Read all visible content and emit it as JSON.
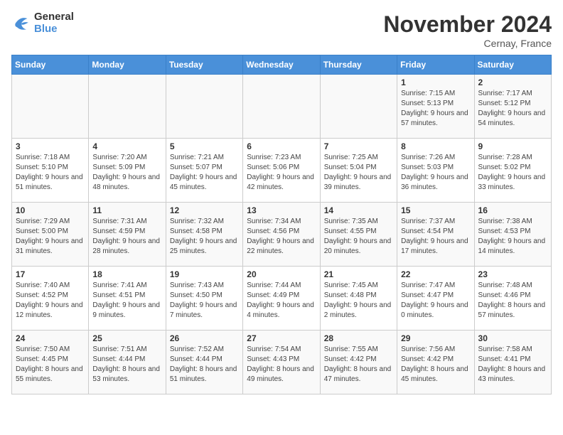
{
  "header": {
    "logo_general": "General",
    "logo_blue": "Blue",
    "month_title": "November 2024",
    "subtitle": "Cernay, France"
  },
  "weekdays": [
    "Sunday",
    "Monday",
    "Tuesday",
    "Wednesday",
    "Thursday",
    "Friday",
    "Saturday"
  ],
  "weeks": [
    [
      {
        "day": "",
        "info": ""
      },
      {
        "day": "",
        "info": ""
      },
      {
        "day": "",
        "info": ""
      },
      {
        "day": "",
        "info": ""
      },
      {
        "day": "",
        "info": ""
      },
      {
        "day": "1",
        "info": "Sunrise: 7:15 AM\nSunset: 5:13 PM\nDaylight: 9 hours\nand 57 minutes."
      },
      {
        "day": "2",
        "info": "Sunrise: 7:17 AM\nSunset: 5:12 PM\nDaylight: 9 hours\nand 54 minutes."
      }
    ],
    [
      {
        "day": "3",
        "info": "Sunrise: 7:18 AM\nSunset: 5:10 PM\nDaylight: 9 hours\nand 51 minutes."
      },
      {
        "day": "4",
        "info": "Sunrise: 7:20 AM\nSunset: 5:09 PM\nDaylight: 9 hours\nand 48 minutes."
      },
      {
        "day": "5",
        "info": "Sunrise: 7:21 AM\nSunset: 5:07 PM\nDaylight: 9 hours\nand 45 minutes."
      },
      {
        "day": "6",
        "info": "Sunrise: 7:23 AM\nSunset: 5:06 PM\nDaylight: 9 hours\nand 42 minutes."
      },
      {
        "day": "7",
        "info": "Sunrise: 7:25 AM\nSunset: 5:04 PM\nDaylight: 9 hours\nand 39 minutes."
      },
      {
        "day": "8",
        "info": "Sunrise: 7:26 AM\nSunset: 5:03 PM\nDaylight: 9 hours\nand 36 minutes."
      },
      {
        "day": "9",
        "info": "Sunrise: 7:28 AM\nSunset: 5:02 PM\nDaylight: 9 hours\nand 33 minutes."
      }
    ],
    [
      {
        "day": "10",
        "info": "Sunrise: 7:29 AM\nSunset: 5:00 PM\nDaylight: 9 hours\nand 31 minutes."
      },
      {
        "day": "11",
        "info": "Sunrise: 7:31 AM\nSunset: 4:59 PM\nDaylight: 9 hours\nand 28 minutes."
      },
      {
        "day": "12",
        "info": "Sunrise: 7:32 AM\nSunset: 4:58 PM\nDaylight: 9 hours\nand 25 minutes."
      },
      {
        "day": "13",
        "info": "Sunrise: 7:34 AM\nSunset: 4:56 PM\nDaylight: 9 hours\nand 22 minutes."
      },
      {
        "day": "14",
        "info": "Sunrise: 7:35 AM\nSunset: 4:55 PM\nDaylight: 9 hours\nand 20 minutes."
      },
      {
        "day": "15",
        "info": "Sunrise: 7:37 AM\nSunset: 4:54 PM\nDaylight: 9 hours\nand 17 minutes."
      },
      {
        "day": "16",
        "info": "Sunrise: 7:38 AM\nSunset: 4:53 PM\nDaylight: 9 hours\nand 14 minutes."
      }
    ],
    [
      {
        "day": "17",
        "info": "Sunrise: 7:40 AM\nSunset: 4:52 PM\nDaylight: 9 hours\nand 12 minutes."
      },
      {
        "day": "18",
        "info": "Sunrise: 7:41 AM\nSunset: 4:51 PM\nDaylight: 9 hours\nand 9 minutes."
      },
      {
        "day": "19",
        "info": "Sunrise: 7:43 AM\nSunset: 4:50 PM\nDaylight: 9 hours\nand 7 minutes."
      },
      {
        "day": "20",
        "info": "Sunrise: 7:44 AM\nSunset: 4:49 PM\nDaylight: 9 hours\nand 4 minutes."
      },
      {
        "day": "21",
        "info": "Sunrise: 7:45 AM\nSunset: 4:48 PM\nDaylight: 9 hours\nand 2 minutes."
      },
      {
        "day": "22",
        "info": "Sunrise: 7:47 AM\nSunset: 4:47 PM\nDaylight: 9 hours\nand 0 minutes."
      },
      {
        "day": "23",
        "info": "Sunrise: 7:48 AM\nSunset: 4:46 PM\nDaylight: 8 hours\nand 57 minutes."
      }
    ],
    [
      {
        "day": "24",
        "info": "Sunrise: 7:50 AM\nSunset: 4:45 PM\nDaylight: 8 hours\nand 55 minutes."
      },
      {
        "day": "25",
        "info": "Sunrise: 7:51 AM\nSunset: 4:44 PM\nDaylight: 8 hours\nand 53 minutes."
      },
      {
        "day": "26",
        "info": "Sunrise: 7:52 AM\nSunset: 4:44 PM\nDaylight: 8 hours\nand 51 minutes."
      },
      {
        "day": "27",
        "info": "Sunrise: 7:54 AM\nSunset: 4:43 PM\nDaylight: 8 hours\nand 49 minutes."
      },
      {
        "day": "28",
        "info": "Sunrise: 7:55 AM\nSunset: 4:42 PM\nDaylight: 8 hours\nand 47 minutes."
      },
      {
        "day": "29",
        "info": "Sunrise: 7:56 AM\nSunset: 4:42 PM\nDaylight: 8 hours\nand 45 minutes."
      },
      {
        "day": "30",
        "info": "Sunrise: 7:58 AM\nSunset: 4:41 PM\nDaylight: 8 hours\nand 43 minutes."
      }
    ]
  ]
}
